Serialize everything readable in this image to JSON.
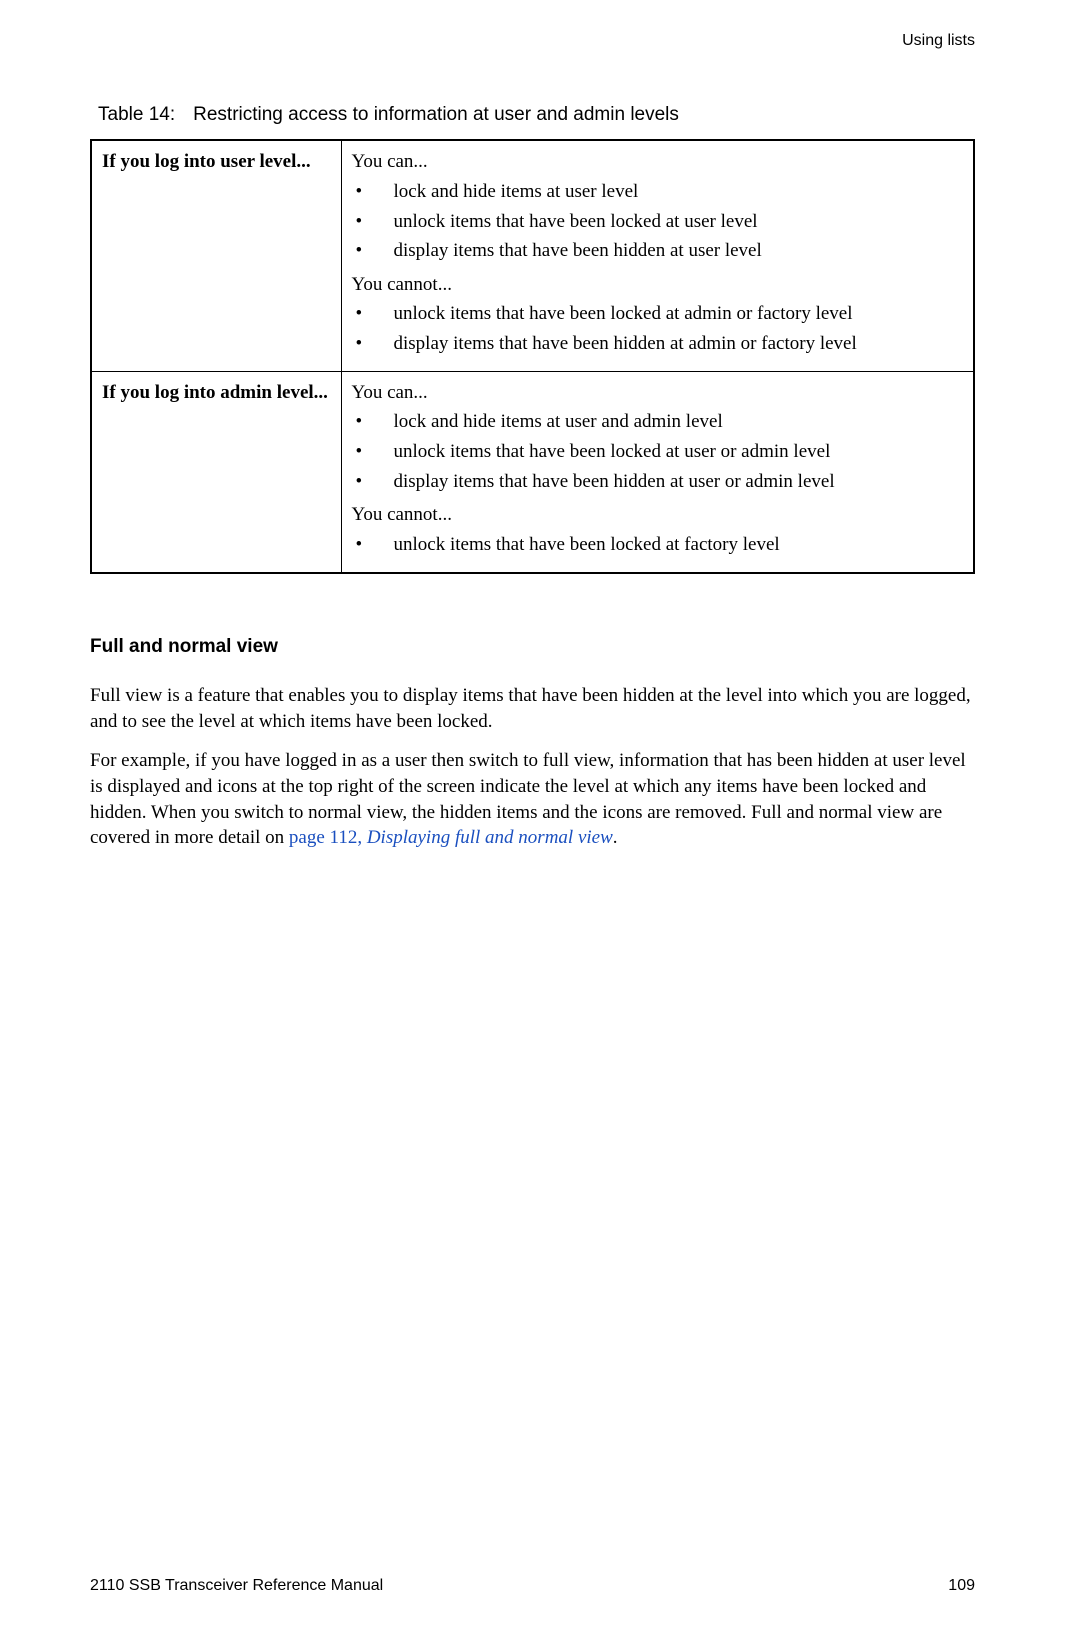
{
  "header": {
    "section": "Using lists"
  },
  "table": {
    "caption_label": "Table 14:",
    "caption_text": "Restricting access to information at user and admin levels",
    "rows": [
      {
        "condition": "If you log into user level...",
        "can_label": "You can...",
        "can_items": [
          "lock and hide items at user level",
          "unlock items that have been locked at user level",
          "display items that have been hidden at user level"
        ],
        "cannot_label": "You cannot...",
        "cannot_items": [
          "unlock items that have been locked at admin or factory level",
          "display items that have been hidden at admin or factory level"
        ]
      },
      {
        "condition": "If you log into admin level...",
        "can_label": "You can...",
        "can_items": [
          "lock and hide items at user and admin level",
          "unlock items that have been locked at user or admin level",
          "display items that have been hidden at user or admin level"
        ],
        "cannot_label": "You cannot...",
        "cannot_items": [
          "unlock items that have been locked at factory level"
        ]
      }
    ]
  },
  "section": {
    "heading": "Full and normal view",
    "para1": "Full view is a feature that enables you to display items that have been hidden at the level into which you are logged, and to see the level at which items have been locked.",
    "para2_a": "For example, if you have logged in as a user then switch to full view, information that has been hidden at user level is displayed and icons at the top right of the screen indicate the level at which any items have been locked and hidden. When you switch to normal view, the hidden items and the icons are removed. Full and normal view are covered in more detail on ",
    "para2_link1": "page 112, ",
    "para2_link2": "Displaying full and normal view",
    "para2_b": "."
  },
  "footer": {
    "left": "2110 SSB Transceiver Reference Manual",
    "right": "109"
  }
}
